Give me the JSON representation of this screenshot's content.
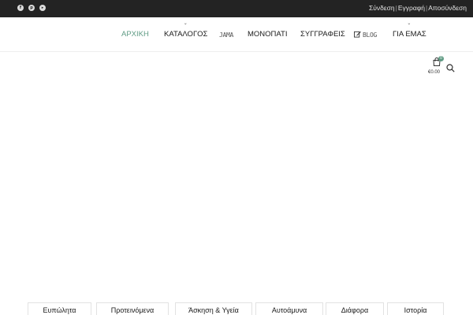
{
  "topbar": {
    "social": [
      {
        "icon": "facebook-icon",
        "glyph": "f"
      },
      {
        "icon": "pinterest-icon",
        "glyph": "p"
      },
      {
        "icon": "youtube-icon",
        "glyph": "▸"
      }
    ],
    "auth": {
      "login": "Σύνδεση",
      "register": "Εγγραφή",
      "logout": "Αποσύνδεση",
      "separator": "|"
    }
  },
  "nav": {
    "items": [
      {
        "label": "ΑΡΧΙΚΗ",
        "active": true
      },
      {
        "label": "ΚΑΤΑΛΟΓΟΣ",
        "has_dropdown": true
      },
      {
        "label": "JAMA"
      },
      {
        "label": "ΜΟΝΟΠΑΤΙ"
      },
      {
        "label": "ΣΥΓΓΡΑΦΕΙΣ"
      },
      {
        "label": "BLOG",
        "icon": "edit-icon"
      },
      {
        "label": "ΓΙΑ ΕΜΑΣ",
        "has_dropdown": true
      }
    ],
    "dropdown_glyph": "⌄"
  },
  "cart": {
    "count": "0",
    "total": "€0.00",
    "icon": "shopping-bag-icon"
  },
  "search": {
    "icon": "search-icon"
  },
  "categories": [
    "Ευπώλητα",
    "Προτεινόμενα",
    "Άσκηση & Υγεία",
    "Αυτοάμυνα",
    "Διάφορα",
    "Ιστορία"
  ],
  "colors": {
    "topbar_bg": "#232323",
    "accent": "#5f9b84",
    "text": "#1a1a1a"
  }
}
